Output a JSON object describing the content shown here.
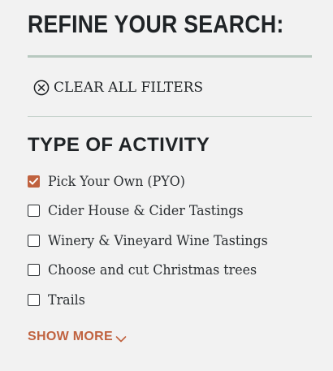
{
  "filters": {
    "heading": "REFINE YOUR SEARCH:",
    "clear_all_label": "CLEAR ALL FILTERS",
    "clear_icon": "close-circle-icon"
  },
  "activity_section": {
    "heading": "TYPE OF ACTIVITY",
    "options": [
      {
        "label": "Pick Your Own (PYO)",
        "checked": true
      },
      {
        "label": "Cider House & Cider Tastings",
        "checked": false
      },
      {
        "label": "Winery & Vineyard Wine Tastings",
        "checked": false
      },
      {
        "label": "Choose and cut Christmas trees",
        "checked": false
      },
      {
        "label": "Trails",
        "checked": false
      }
    ],
    "show_more_label": "SHOW MORE",
    "show_more_icon": "chevron-down-icon"
  },
  "colors": {
    "background": "#f2f2f2",
    "text": "#1f2326",
    "accent": "#c0623f",
    "divider": "#b8c9c0"
  }
}
